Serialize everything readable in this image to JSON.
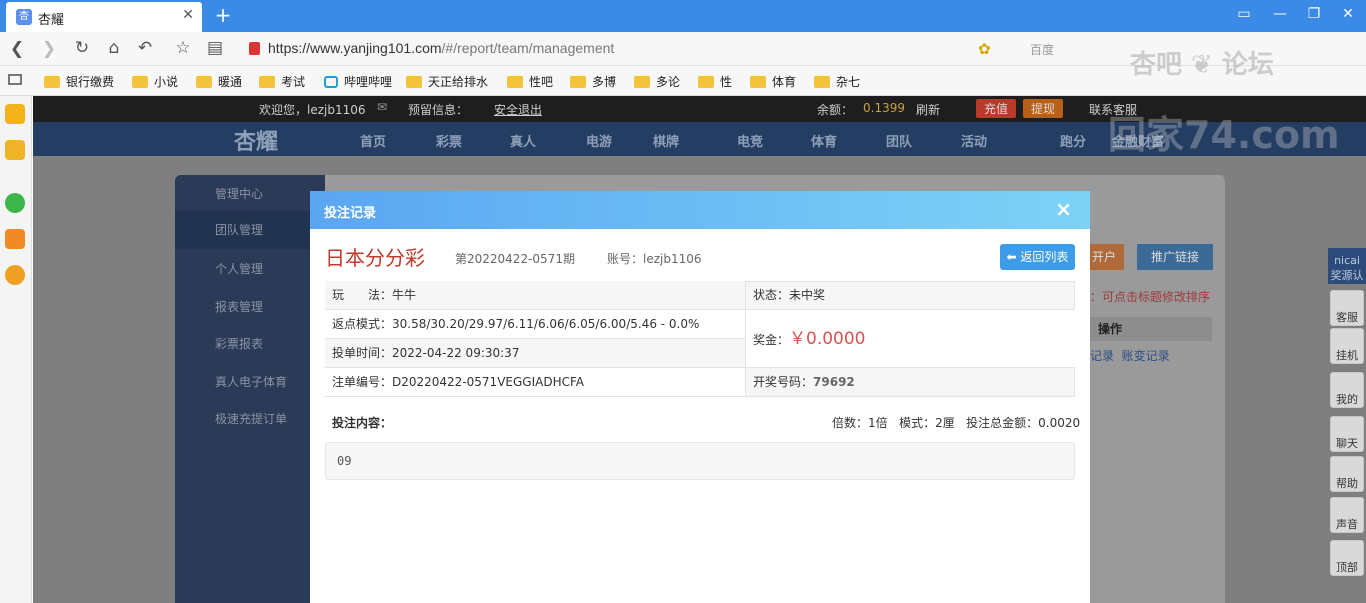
{
  "browser": {
    "tab_title": "杏耀",
    "tab_icon": "app-icon",
    "url_base": "https://www.yanjing101.com",
    "url_path": "/#/report/team/management",
    "search_placeholder": "百度",
    "bookmarks": [
      "银行缴费",
      "小说",
      "暖通",
      "考试",
      "哔哩哔哩",
      "天正给排水",
      "性吧",
      "多博",
      "多论",
      "性",
      "体育",
      "杂七"
    ]
  },
  "topbar": {
    "welcome": "欢迎您，lezjb1106",
    "message_label": "预留信息：",
    "logout": "安全退出",
    "balance_label": "余额：",
    "balance": "0.1399",
    "refresh": "刷新",
    "deposit": "充值",
    "withdraw": "提现",
    "support": "联系客服"
  },
  "nav": {
    "logo": "杏耀",
    "items": [
      "首页",
      "彩票",
      "真人",
      "电游",
      "棋牌",
      "电竞",
      "体育",
      "团队",
      "活动",
      "跑分",
      "金融财富"
    ]
  },
  "sidebar": {
    "items": [
      "管理中心",
      "团队管理",
      "个人管理",
      "报表管理",
      "彩票报表",
      "真人电子体育",
      "极速充提订单"
    ]
  },
  "background": {
    "btn_open_account": "开户",
    "btn_promo_link": "推广链接",
    "sort_hint": "：可点击标题修改排序",
    "col_action": "操作",
    "row_links": "记录  账变记录"
  },
  "rightdock": {
    "top_label": "nicai 奖源认",
    "items": [
      "客服",
      "挂机",
      "我的",
      "聊天",
      "帮助",
      "声音",
      "顶部"
    ]
  },
  "modal": {
    "title": "投注记录",
    "close": "×",
    "lottery_name": "日本分分彩",
    "issue": "第20220422-0571期",
    "account": "账号：lezjb1106",
    "back_button": "返回列表",
    "play_label": "玩　　法：牛牛",
    "status": "状态：未中奖",
    "rebate": "返点模式：30.58/30.20/29.97/6.11/6.06/6.05/6.00/5.46 - 0.0%",
    "prize_label": "奖金：",
    "prize_amount": "￥0.0000",
    "bet_time": "投单时间：2022-04-22 09:30:37",
    "order_no": "注单编号：D20220422-0571VEGGIADHCFA",
    "draw_label": "开奖号码：",
    "draw_number": "79692",
    "bet_content_label": "投注内容：",
    "bet_meta": "倍数：1倍   模式：2厘   投注总金额：0.0020",
    "bet_content": "09"
  },
  "watermark": {
    "line1": "杏吧 ❦ 论坛",
    "line2": "回家74.com"
  },
  "colors": {
    "accent": "#3c9ce8",
    "lottery": "#c0392b",
    "prize": "#d9534f"
  }
}
